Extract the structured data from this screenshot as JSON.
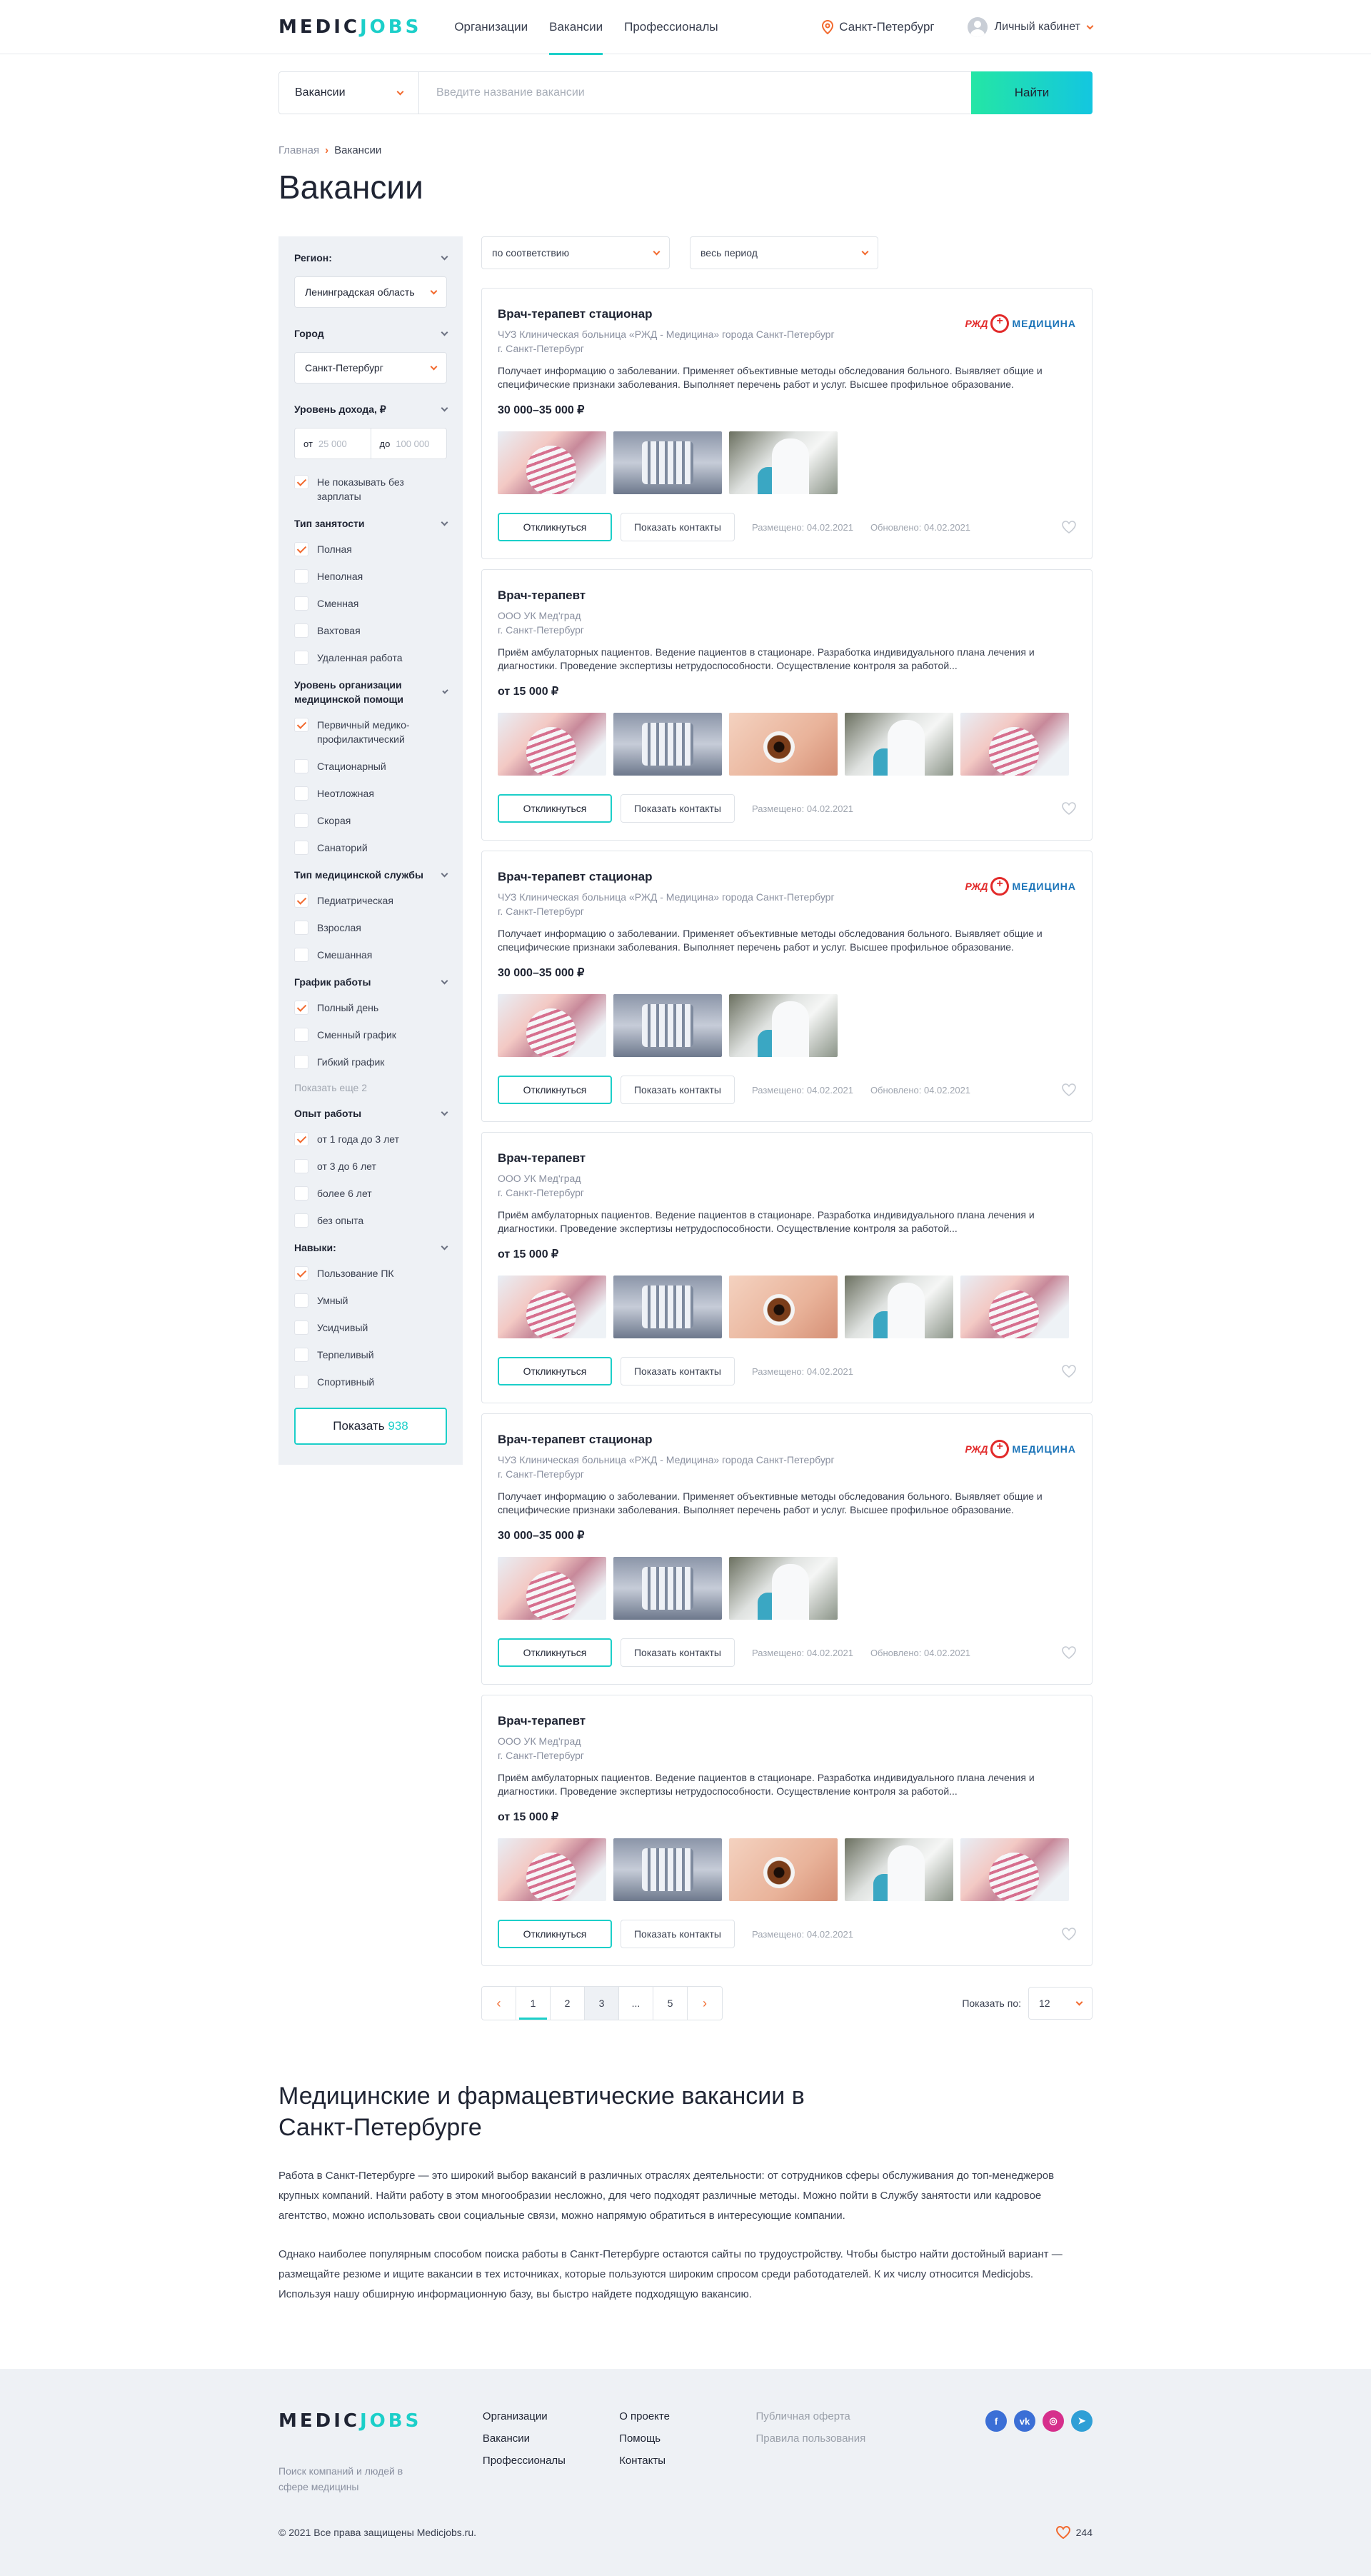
{
  "header": {
    "logo_a": "MEDIC",
    "logo_b": "JOBS",
    "nav": [
      "Организации",
      "Вакансии",
      "Профессионалы"
    ],
    "city": "Санкт-Петербург",
    "account": "Личный кабинет"
  },
  "search": {
    "category": "Вакансии",
    "placeholder": "Введите название вакансии",
    "button": "Найти"
  },
  "breadcrumb": {
    "home": "Главная",
    "current": "Вакансии"
  },
  "page_title": "Вакансии",
  "filters": {
    "region_label": "Регион:",
    "region_value": "Ленинградская область",
    "city_label": "Город",
    "city_value": "Санкт-Петербург",
    "income_label": "Уровень дохода, ₽",
    "income_from_label": "от",
    "income_from_ph": "25 000",
    "income_to_label": "до",
    "income_to_ph": "100 000",
    "no_salary": "Не показывать без зарплаты",
    "employment_label": "Тип занятости",
    "employment": [
      "Полная",
      "Неполная",
      "Сменная",
      "Вахтовая",
      "Удаленная работа"
    ],
    "org_level_label": "Уровень организации медицинской помощи",
    "org_level": [
      "Первичный медико-профилактический",
      "Стационарный",
      "Неотложная",
      "Скорая",
      "Санаторий"
    ],
    "service_label": "Тип медицинской службы",
    "service": [
      "Педиатрическая",
      "Взрослая",
      "Смешанная"
    ],
    "schedule_label": "График работы",
    "schedule": [
      "Полный день",
      "Сменный график",
      "Гибкий график"
    ],
    "schedule_more": "Показать еще 2",
    "experience_label": "Опыт работы",
    "experience": [
      "от 1 года до 3 лет",
      "от 3 до 6 лет",
      "более 6 лет",
      "без опыта"
    ],
    "skills_label": "Навыки:",
    "skills": [
      "Пользование ПК",
      "Умный",
      "Усидчивый",
      "Терпеливый",
      "Спортивный"
    ],
    "show_button": "Показать",
    "show_count": "938"
  },
  "sort": {
    "order": "по соответствию",
    "period": "весь период"
  },
  "cards": [
    {
      "title": "Врач-терапевт стационар",
      "org": "ЧУЗ Клиническая больница «РЖД - Медицина» города Санкт-Петербург",
      "city": "г. Санкт-Петербург",
      "desc": "Получает информацию о заболевании. Применяет объективные методы обследования больного. Выявляет общие и специфические признаки заболевания. Выполняет перечень работ и услуг. Высшее профильное образование.",
      "salary": "30 000–35 000 ₽",
      "posted": "Размещено: 04.02.2021",
      "updated": "Обновлено: 04.02.2021",
      "logo": true,
      "images": [
        "pregnant",
        "robot",
        "lab"
      ]
    },
    {
      "title": "Врач-терапевт",
      "org": "ООО УК Мед'град",
      "city": "г. Санкт-Петербург",
      "desc": "Приём амбулаторных пациентов. Ведение пациентов в стационаре. Разработка индивидуального плана лечения и диагностики. Проведение экспертизы нетрудоспособности. Осуществление контроля за работой...",
      "salary": "от 15 000 ₽",
      "posted": "Размещено: 04.02.2021",
      "updated": "",
      "logo": false,
      "images": [
        "pregnant",
        "robot",
        "eye",
        "lab",
        "pregnant"
      ]
    },
    {
      "title": "Врач-терапевт стационар",
      "org": "ЧУЗ Клиническая больница «РЖД - Медицина» города Санкт-Петербург",
      "city": "г. Санкт-Петербург",
      "desc": "Получает информацию о заболевании. Применяет объективные методы обследования больного. Выявляет общие и специфические признаки заболевания. Выполняет перечень работ и услуг. Высшее профильное образование.",
      "salary": "30 000–35 000 ₽",
      "posted": "Размещено: 04.02.2021",
      "updated": "Обновлено: 04.02.2021",
      "logo": true,
      "images": [
        "pregnant",
        "robot",
        "lab"
      ]
    },
    {
      "title": "Врач-терапевт",
      "org": "ООО УК Мед'град",
      "city": "г. Санкт-Петербург",
      "desc": "Приём амбулаторных пациентов. Ведение пациентов в стационаре. Разработка индивидуального плана лечения и диагностики. Проведение экспертизы нетрудоспособности. Осуществление контроля за работой...",
      "salary": "от 15 000 ₽",
      "posted": "Размещено: 04.02.2021",
      "updated": "",
      "logo": false,
      "images": [
        "pregnant",
        "robot",
        "eye",
        "lab",
        "pregnant"
      ]
    },
    {
      "title": "Врач-терапевт стационар",
      "org": "ЧУЗ Клиническая больница «РЖД - Медицина» города Санкт-Петербург",
      "city": "г. Санкт-Петербург",
      "desc": "Получает информацию о заболевании. Применяет объективные методы обследования больного. Выявляет общие и специфические признаки заболевания. Выполняет перечень работ и услуг. Высшее профильное образование.",
      "salary": "30 000–35 000 ₽",
      "posted": "Размещено: 04.02.2021",
      "updated": "Обновлено: 04.02.2021",
      "logo": true,
      "images": [
        "pregnant",
        "robot",
        "lab"
      ]
    },
    {
      "title": "Врач-терапевт",
      "org": "ООО УК Мед'град",
      "city": "г. Санкт-Петербург",
      "desc": "Приём амбулаторных пациентов. Ведение пациентов в стационаре. Разработка индивидуального плана лечения и диагностики. Проведение экспертизы нетрудоспособности. Осуществление контроля за работой...",
      "salary": "от 15 000 ₽",
      "posted": "Размещено: 04.02.2021",
      "updated": "",
      "logo": false,
      "images": [
        "pregnant",
        "robot",
        "eye",
        "lab",
        "pregnant"
      ]
    }
  ],
  "card_labels": {
    "apply": "Откликнуться",
    "contacts": "Показать контакты",
    "logo_rzd": "РЖД",
    "logo_med": "МЕДИЦИНА"
  },
  "pagination": {
    "pages": [
      "1",
      "2",
      "3",
      "...",
      "5"
    ],
    "per_page_label": "Показать по:",
    "per_page": "12"
  },
  "seo": {
    "title": "Медицинские и фармацевтические вакансии в Санкт-Петербурге",
    "p1": "Работа в Санкт-Петербурге — это широкий выбор вакансий в различных отраслях деятельности: от сотрудников сферы обслуживания до топ-менеджеров крупных компаний. Найти работу в этом многообразии несложно, для чего подходят различные методы. Можно пойти в Службу занятости или кадровое агентство, можно использовать свои социальные связи, можно напрямую обратиться в интересующие компании.",
    "p2": "Однако наиболее популярным способом поиска работы в Санкт-Петербурге остаются сайты по трудоустройству. Чтобы быстро найти достойный вариант — размещайте резюме и ищите вакансии в тех источниках, которые пользуются широким спросом среди работодателей. К их числу относится Medicjobs. Используя нашу обширную информационную базу, вы быстро найдете подходящую вакансию."
  },
  "footer": {
    "tagline": "Поиск компаний и людей в сфере медицины",
    "col1": [
      "Организации",
      "Вакансии",
      "Профессионалы"
    ],
    "col2": [
      "О проекте",
      "Помощь",
      "Контакты"
    ],
    "col3": [
      "Публичная оферта",
      "Правила пользования"
    ],
    "copyright": "© 2021 Все права защищены Medicjobs.ru.",
    "likes": "244",
    "socials": [
      {
        "name": "facebook-icon",
        "glyph": "f",
        "color": "#3b6fd6"
      },
      {
        "name": "vk-icon",
        "glyph": "vk",
        "color": "#3b6fd6"
      },
      {
        "name": "instagram-icon",
        "glyph": "◎",
        "color": "#d62f8c"
      },
      {
        "name": "telegram-icon",
        "glyph": "➤",
        "color": "#2f9fd6"
      }
    ]
  }
}
